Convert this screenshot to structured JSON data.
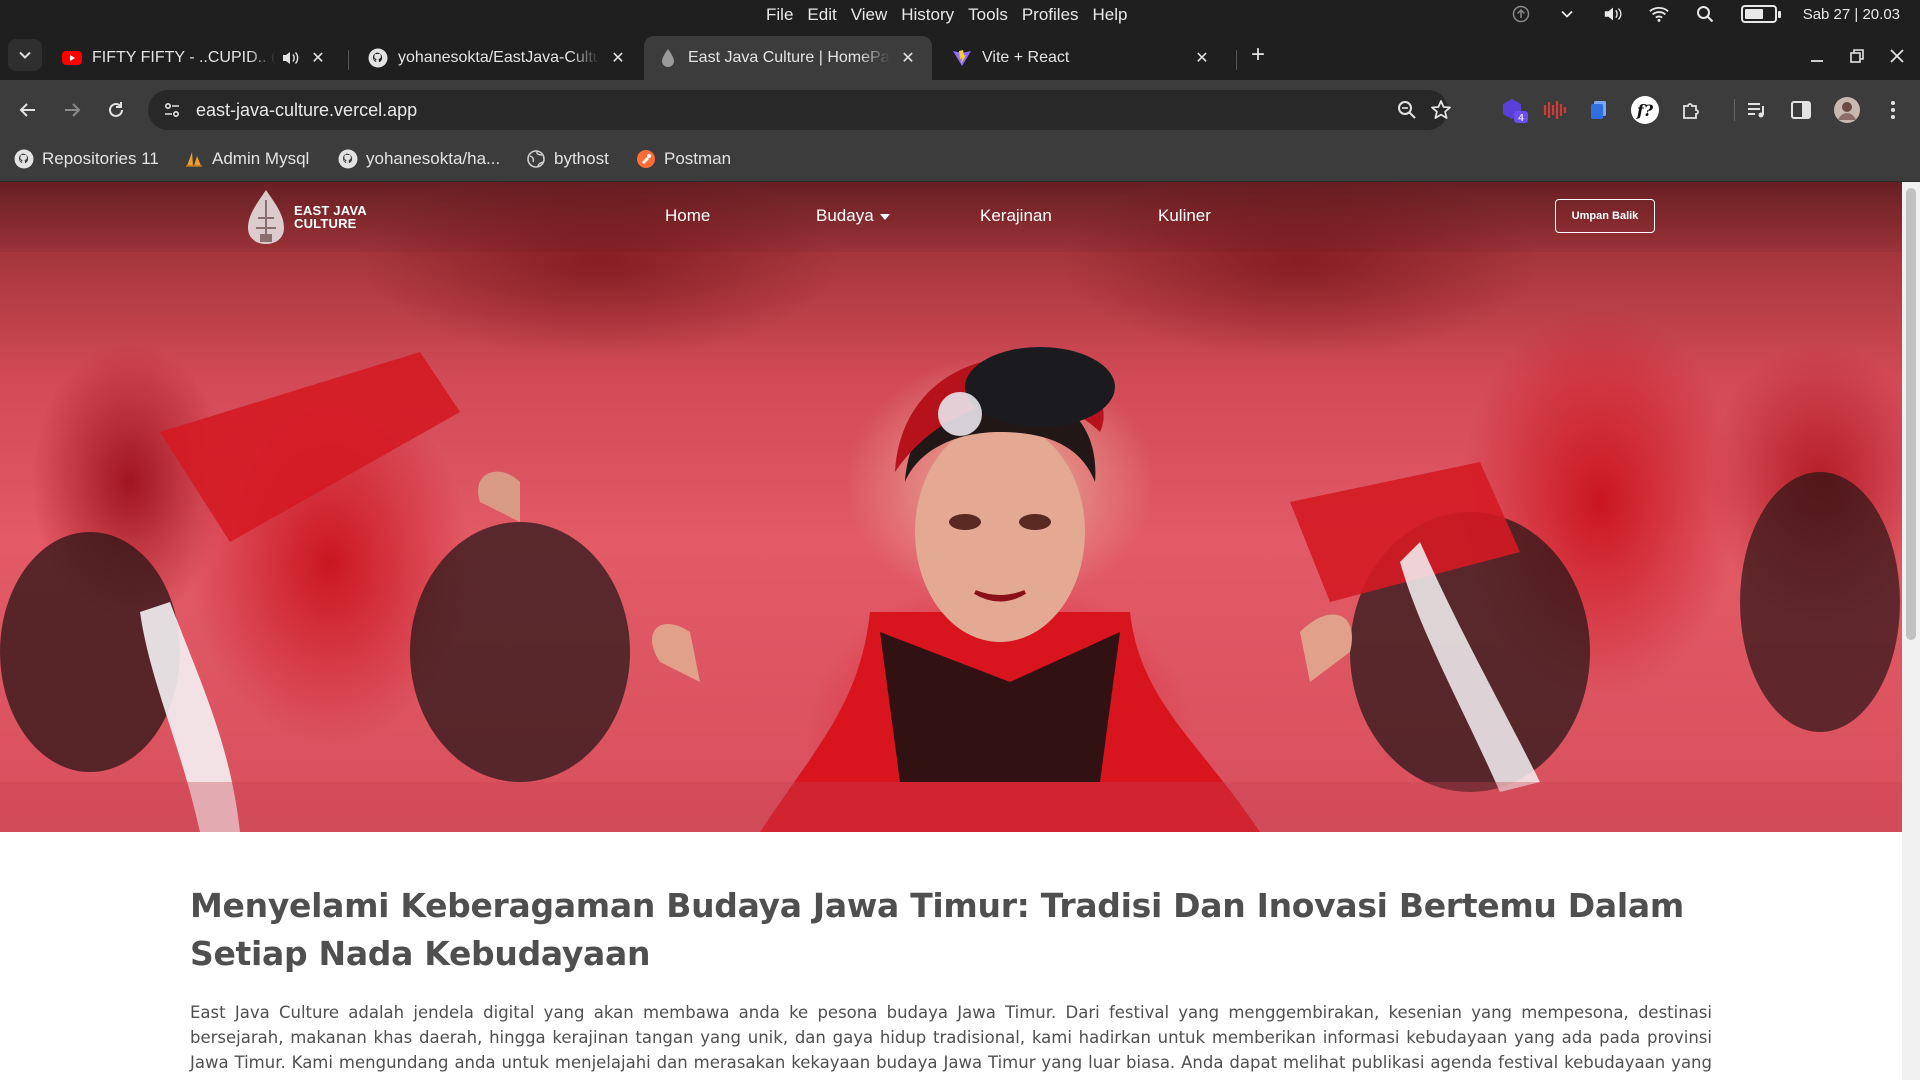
{
  "os": {
    "menu": [
      "File",
      "Edit",
      "View",
      "History",
      "Tools",
      "Profiles",
      "Help"
    ],
    "clock": "Sab 27 | 20.03",
    "battery_level": 0.65
  },
  "tabs": [
    {
      "title": "FIFTY FIFTY - ..CUPID.. (Twin Ver.)",
      "icon": "youtube-icon",
      "audio": true,
      "active": false
    },
    {
      "title": "yohanesokta/EastJava-Culture",
      "icon": "github-icon",
      "active": false
    },
    {
      "title": "East Java Culture | HomePage",
      "icon": "drop-icon",
      "active": true
    },
    {
      "title": "Vite + React",
      "icon": "vite-icon",
      "active": false
    }
  ],
  "toolbar": {
    "url": "east-java-culture.vercel.app",
    "extension_badge": "4"
  },
  "bookmarks": [
    {
      "label": "Repositories 11",
      "icon": "github-icon"
    },
    {
      "label": "Admin Mysql",
      "icon": "sailboat-icon"
    },
    {
      "label": "yohanesokta/ha...",
      "icon": "github-icon"
    },
    {
      "label": "bythost",
      "icon": "globe-icon"
    },
    {
      "label": "Postman",
      "icon": "postman-icon"
    }
  ],
  "site": {
    "logo_line1": "EAST JAVA",
    "logo_line2": "CULTURE",
    "nav": {
      "home": "Home",
      "budaya": "Budaya",
      "kerajinan": "Kerajinan",
      "kuliner": "Kuliner"
    },
    "feedback_button": "Umpan Balik",
    "headline": "Menyelami Keberagaman Budaya Jawa Timur: Tradisi Dan Inovasi Bertemu Dalam Setiap Nada Kebudayaan",
    "intro": "East Java Culture adalah jendela digital yang akan membawa anda ke pesona budaya Jawa Timur. Dari festival yang menggembirakan, kesenian yang mempesona, destinasi bersejarah, makanan khas daerah, hingga kerajinan tangan yang unik, dan gaya hidup tradisional, kami hadirkan untuk memberikan informasi kebudayaan yang ada pada provinsi Jawa Timur. Kami mengundang anda untuk menjelajahi dan merasakan kekayaan budaya Jawa Timur yang luar biasa. Anda dapat melihat publikasi agenda festival kebudayaan yang akan datang melalui"
  },
  "colors": {
    "chrome_dark": "#1f1f1f",
    "chrome_toolbar": "#3c3c3c",
    "headline_text": "#4f4f4f",
    "hero_red": "#d8505d"
  }
}
